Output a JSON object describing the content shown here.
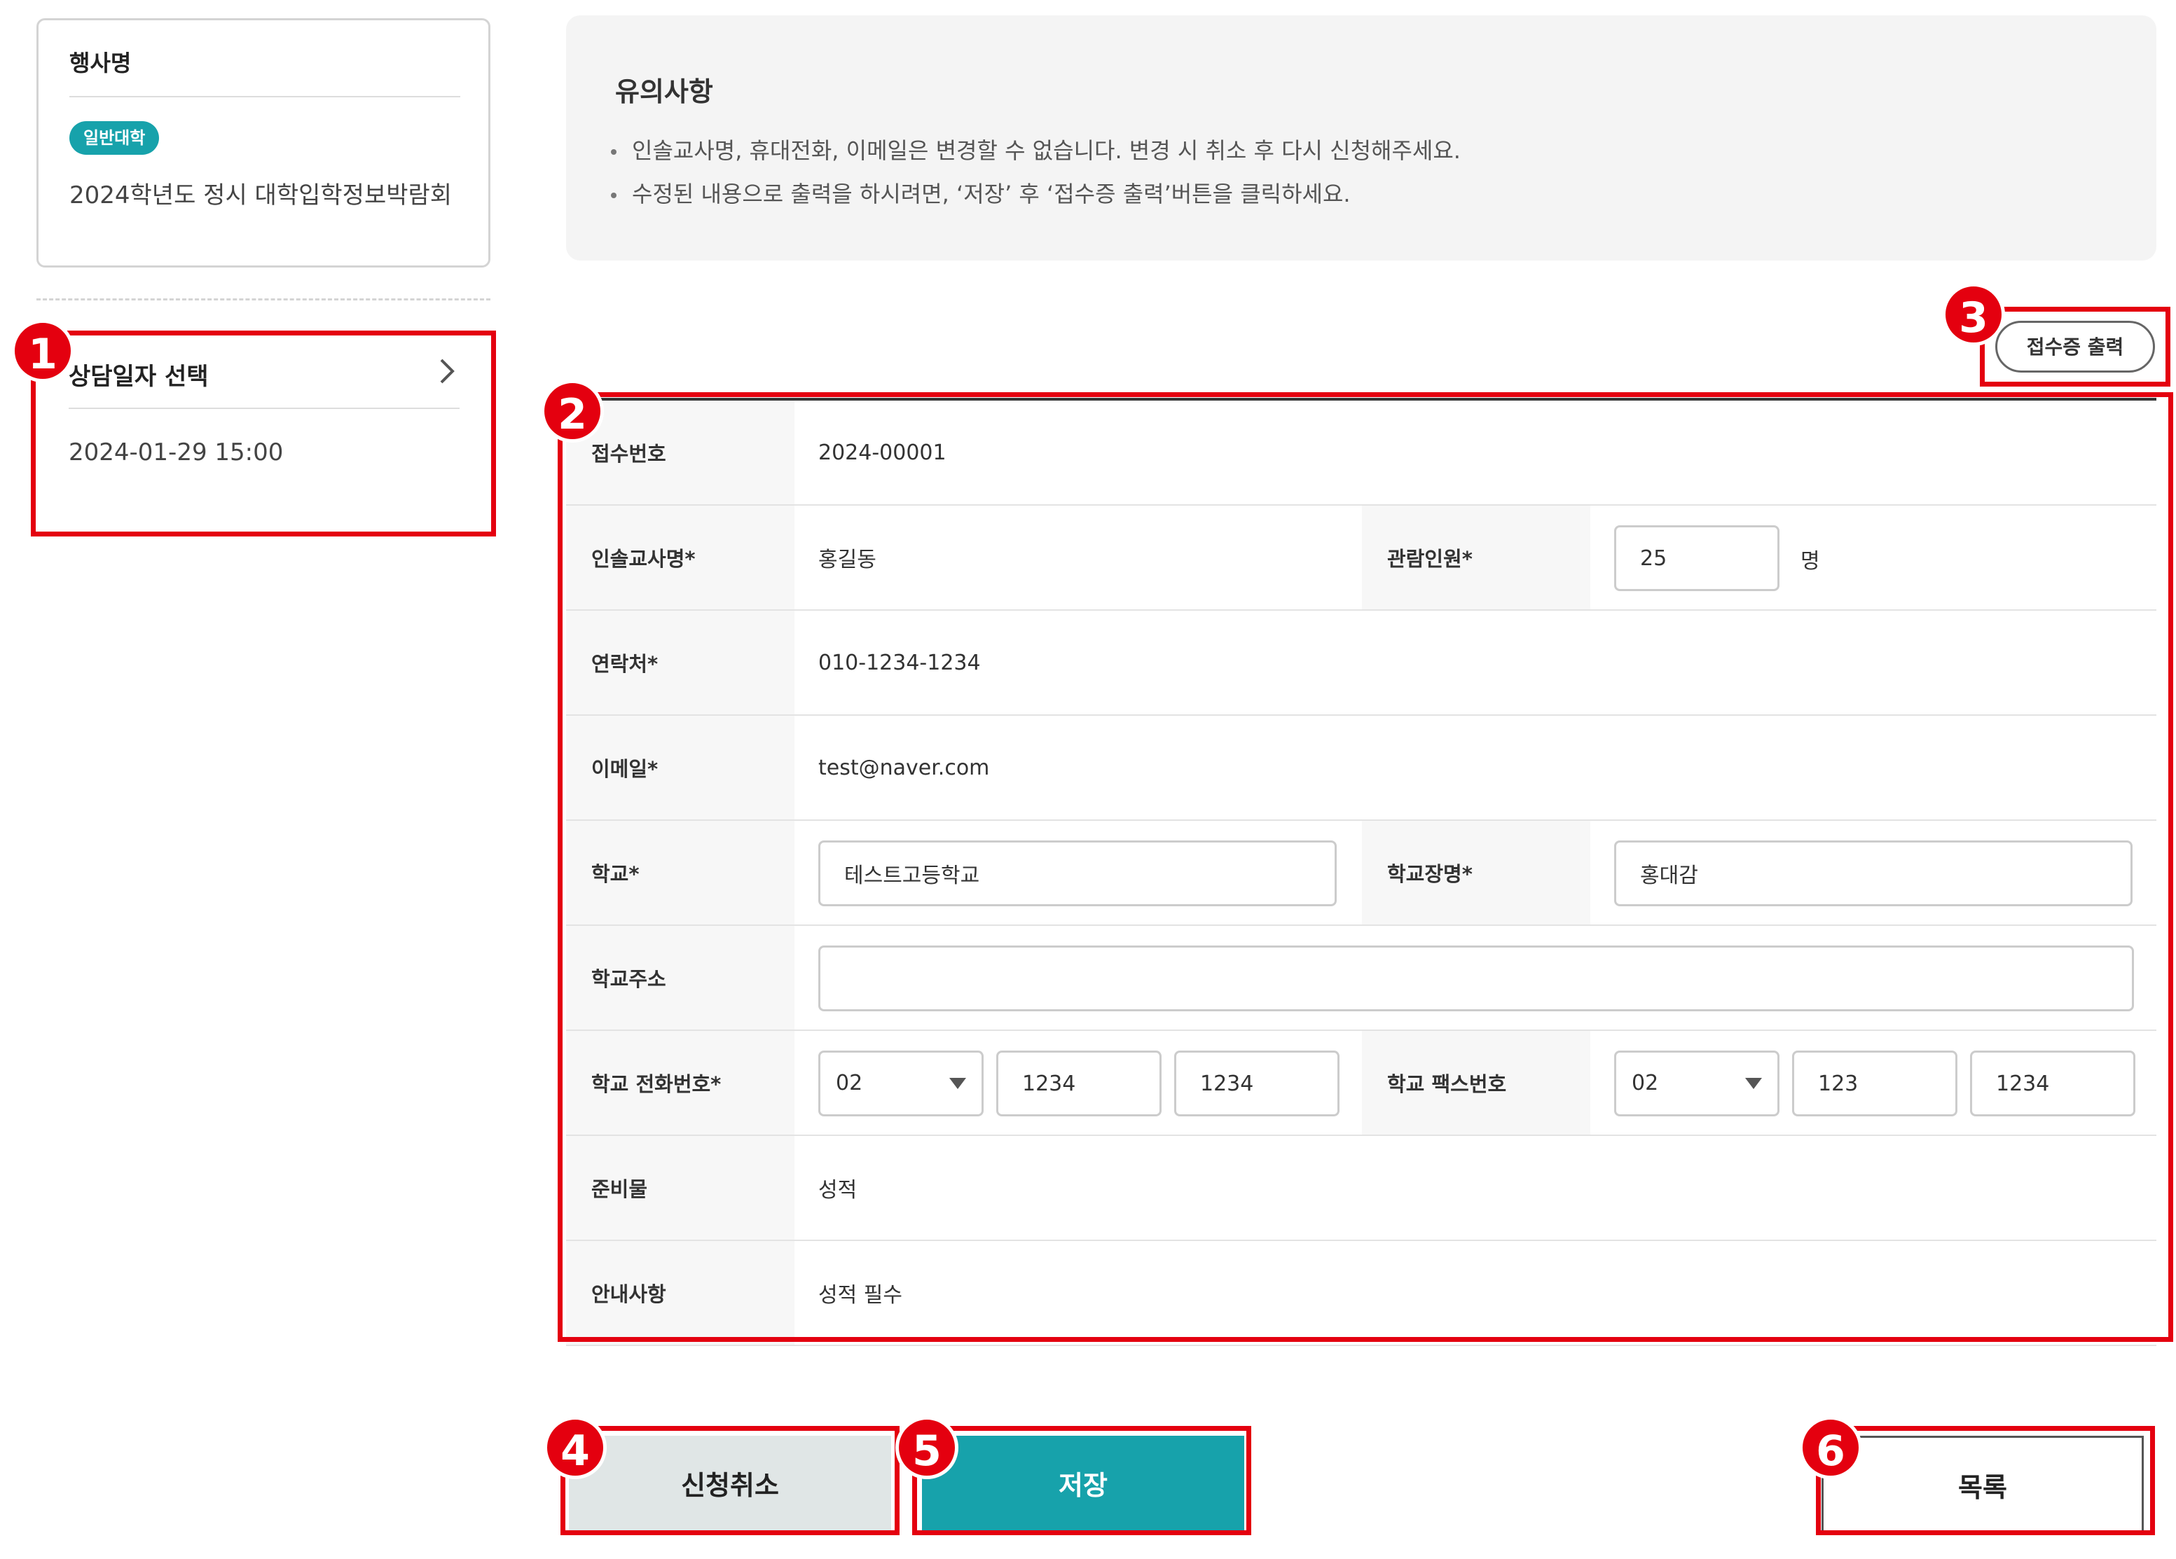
{
  "event": {
    "title": "행사명",
    "badge": "일반대학",
    "name": "2024학년도 정시 대학입학정보박람회"
  },
  "schedule": {
    "label": "상담일자 선택",
    "value": "2024-01-29 15:00"
  },
  "notice": {
    "title": "유의사항",
    "items": [
      "인솔교사명, 휴대전화, 이메일은 변경할 수 없습니다. 변경 시 취소 후 다시 신청해주세요.",
      "수정된 내용으로 출력을 하시려면, ‘저장’ 후 ‘접수증 출력’버튼을 클릭하세요."
    ]
  },
  "print_button": "접수증 출력",
  "form": {
    "receipt_no": {
      "label": "접수번호",
      "value": "2024-00001"
    },
    "teacher": {
      "label": "인솔교사명*",
      "value": "홍길동"
    },
    "visitors": {
      "label": "관람인원*",
      "value": "25",
      "unit": "명"
    },
    "contact": {
      "label": "연락처*",
      "value": "010-1234-1234"
    },
    "email": {
      "label": "이메일*",
      "value": "test@naver.com"
    },
    "school": {
      "label": "학교*",
      "value": "테스트고등학교"
    },
    "principal": {
      "label": "학교장명*",
      "value": "홍대감"
    },
    "address": {
      "label": "학교주소",
      "value": ""
    },
    "phone": {
      "label": "학교 전화번호*",
      "area": "02",
      "mid": "1234",
      "last": "1234"
    },
    "fax": {
      "label": "학교 팩스번호",
      "area": "02",
      "mid": "123",
      "last": "1234"
    },
    "materials": {
      "label": "준비물",
      "value": "성적"
    },
    "guide": {
      "label": "안내사항",
      "value": "성적 필수"
    }
  },
  "buttons": {
    "cancel": "신청취소",
    "save": "저장",
    "list": "목록"
  },
  "annotations": [
    "1",
    "2",
    "3",
    "4",
    "5",
    "6"
  ],
  "colors": {
    "accent": "#17a2ab",
    "highlight": "#e4000f"
  }
}
